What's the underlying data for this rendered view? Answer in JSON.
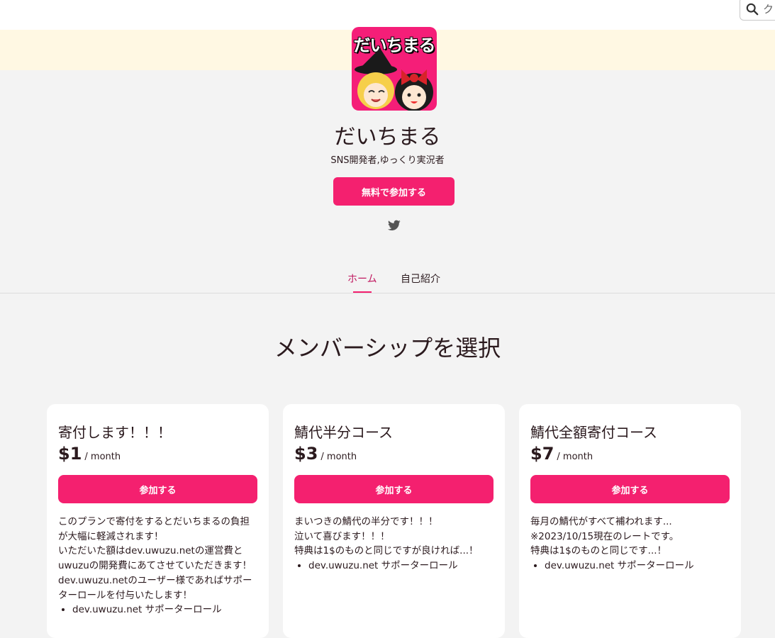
{
  "search": {
    "placeholder": "ク"
  },
  "creator": {
    "avatar_text": "だいちまる",
    "name": "だいちまる",
    "description": "SNS開発者,ゆっくり実況者",
    "join_free_label": "無料で参加する",
    "social": [
      "twitter-icon"
    ]
  },
  "tabs": [
    {
      "label": "ホーム",
      "active": true
    },
    {
      "label": "自己紹介",
      "active": false
    }
  ],
  "section_title": "メンバーシップを選択",
  "colors": {
    "accent": "#f4206f",
    "cover": "#fff8e3",
    "background": "#f3f3f3"
  },
  "plans": [
    {
      "name": "寄付します！！！",
      "price": "$1",
      "period": "/ month",
      "join_label": "参加する",
      "description_lines": [
        "このプランで寄付をするとだいちまるの負担",
        "が大幅に軽減されます！",
        "いただいた額はdev.uwuzu.netの運営費と",
        "uwuzuの開発費にあてさせていただきます！",
        "dev.uwuzu.netのユーザー様であればサポー",
        "ターロールを付与いたします！"
      ],
      "benefits": [
        "dev.uwuzu.net サポーターロール"
      ]
    },
    {
      "name": "鯖代半分コース",
      "price": "$3",
      "period": "/ month",
      "join_label": "参加する",
      "description_lines": [
        "まいつきの鯖代の半分です！！！",
        "泣いて喜びます！！！",
        "特典は1$のものと同じですが良ければ...！"
      ],
      "benefits": [
        "dev.uwuzu.net サポーターロール"
      ]
    },
    {
      "name": "鯖代全額寄付コース",
      "price": "$7",
      "period": "/ month",
      "join_label": "参加する",
      "description_lines": [
        "毎月の鯖代がすべて補われます...",
        "※2023/10/15現在のレートです。",
        "特典は1$のものと同じです...！"
      ],
      "benefits": [
        "dev.uwuzu.net サポーターロール"
      ]
    }
  ]
}
